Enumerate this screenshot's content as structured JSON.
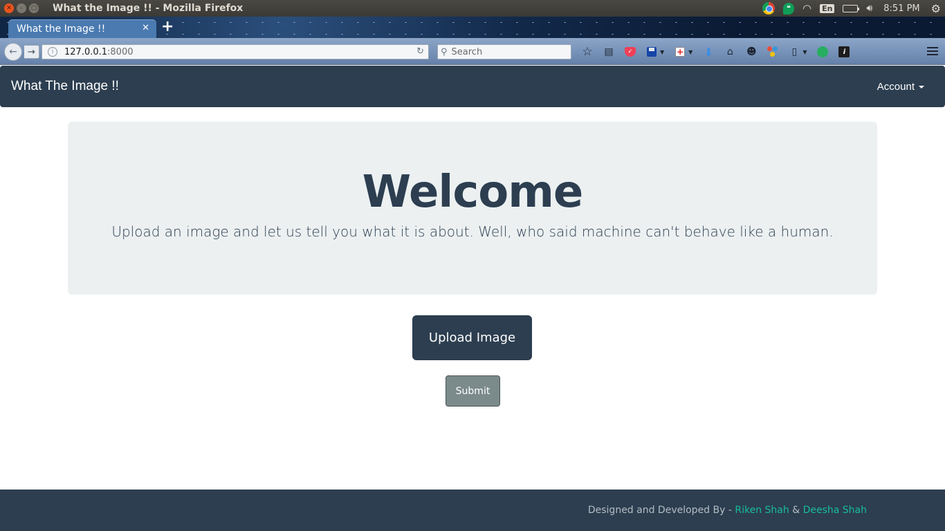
{
  "os": {
    "window_title": "What the Image !! - Mozilla Firefox",
    "input_language": "En",
    "clock": "8:51 PM"
  },
  "browser": {
    "tab_title": "What the Image !!",
    "url_host": "127.0.0.1",
    "url_port": ":8000",
    "search_placeholder": "Search"
  },
  "site": {
    "brand": "What The Image !!",
    "account_label": "Account",
    "jumbotron": {
      "title": "Welcome",
      "subtitle": "Upload an image and let us tell you what it is about. Well, who said machine can't behave like a human."
    },
    "upload_label": "Upload Image",
    "submit_label": "Submit",
    "footer": {
      "prefix": "Designed and Developed By - ",
      "author1": "Riken Shah",
      "separator": " & ",
      "author2": "Deesha Shah"
    }
  },
  "colors": {
    "primary": "#2c3e50",
    "light": "#ecf0f1",
    "success": "#18bc9c",
    "submit": "#7b8a8b"
  }
}
